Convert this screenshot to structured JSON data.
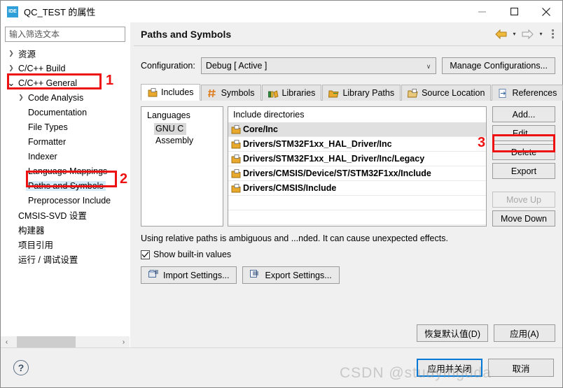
{
  "window": {
    "title": "QC_TEST 的属性",
    "app_icon_text": "IDE",
    "controls": {
      "minimize": "minimize-icon",
      "maximize": "maximize-icon",
      "close": "close-icon"
    }
  },
  "sidebar": {
    "filter_placeholder": "输入筛选文本",
    "filter_value": "",
    "items": [
      {
        "label": "资源",
        "arrow": "›",
        "indent": 0,
        "selected": false
      },
      {
        "label": "C/C++ Build",
        "arrow": "›",
        "indent": 0,
        "selected": false
      },
      {
        "label": "C/C++ General",
        "arrow": "v",
        "indent": 0,
        "selected": false
      },
      {
        "label": "Code Analysis",
        "arrow": "›",
        "indent": 1,
        "selected": false
      },
      {
        "label": "Documentation",
        "arrow": "",
        "indent": 1,
        "selected": false
      },
      {
        "label": "File Types",
        "arrow": "",
        "indent": 1,
        "selected": false
      },
      {
        "label": "Formatter",
        "arrow": "",
        "indent": 1,
        "selected": false
      },
      {
        "label": "Indexer",
        "arrow": "",
        "indent": 1,
        "selected": false
      },
      {
        "label": "Language Mappings",
        "arrow": "",
        "indent": 1,
        "selected": false
      },
      {
        "label": "Paths and Symbols",
        "arrow": "",
        "indent": 1,
        "selected": true
      },
      {
        "label": "Preprocessor Include",
        "arrow": "",
        "indent": 1,
        "selected": false
      },
      {
        "label": "CMSIS-SVD 设置",
        "arrow": "",
        "indent": 0,
        "selected": false
      },
      {
        "label": "构建器",
        "arrow": "",
        "indent": 0,
        "selected": false
      },
      {
        "label": "项目引用",
        "arrow": "",
        "indent": 0,
        "selected": false
      },
      {
        "label": "运行 / 调试设置",
        "arrow": "",
        "indent": 0,
        "selected": false
      }
    ],
    "scroll_left": "‹",
    "scroll_right": "›"
  },
  "page": {
    "title": "Paths and Symbols",
    "nav": {
      "back": "back-arrow-icon",
      "back_caret": "▾",
      "forward": "forward-arrow-icon",
      "forward_caret": "▾",
      "more": "view-menu-icon"
    }
  },
  "configuration": {
    "label": "Configuration:",
    "value": "Debug  [ Active ]",
    "caret": "∨",
    "manage_button": "Manage Configurations..."
  },
  "tabs": [
    {
      "label": "Includes",
      "icon": "includes-icon",
      "active": true
    },
    {
      "label": "Symbols",
      "icon": "symbols-hash-icon",
      "active": false
    },
    {
      "label": "Libraries",
      "icon": "libraries-icon",
      "active": false
    },
    {
      "label": "Library Paths",
      "icon": "library-paths-icon",
      "active": false
    },
    {
      "label": "Source Location",
      "icon": "source-location-icon",
      "active": false
    },
    {
      "label": "References",
      "icon": "references-icon",
      "active": false
    }
  ],
  "languages": {
    "title": "Languages",
    "items": [
      {
        "label": "GNU C",
        "selected": true
      },
      {
        "label": "Assembly",
        "selected": false
      }
    ]
  },
  "include_directories": {
    "title": "Include directories",
    "rows": [
      {
        "label": "Core/Inc",
        "selected": true
      },
      {
        "label": "Drivers/STM32F1xx_HAL_Driver/Inc",
        "selected": false
      },
      {
        "label": "Drivers/STM32F1xx_HAL_Driver/Inc/Legacy",
        "selected": false
      },
      {
        "label": "Drivers/CMSIS/Device/ST/STM32F1xx/Include",
        "selected": false
      },
      {
        "label": "Drivers/CMSIS/Include",
        "selected": false
      }
    ],
    "empty_rows": 2
  },
  "side_buttons": [
    {
      "label": "Add...",
      "disabled": false,
      "highlighted": true
    },
    {
      "label": "Edit...",
      "disabled": false,
      "highlighted": false
    },
    {
      "label": "Delete",
      "disabled": false,
      "highlighted": false
    },
    {
      "label": "Export",
      "disabled": false,
      "highlighted": false
    },
    {
      "label": "Move Up",
      "disabled": true,
      "highlighted": false
    },
    {
      "label": "Move Down",
      "disabled": false,
      "highlighted": false
    }
  ],
  "note": "Using relative paths is ambiguous and ...nded. It can cause unexpected effects.",
  "show_builtin": {
    "label": "Show built-in values",
    "checked": true,
    "check_glyph": "✓"
  },
  "settings_buttons": [
    {
      "label": "Import Settings...",
      "icon": "import-settings-icon"
    },
    {
      "label": "Export Settings...",
      "icon": "export-settings-icon"
    }
  ],
  "restore_row": [
    {
      "label": "恢复默认值(D)"
    },
    {
      "label": "应用(A)"
    }
  ],
  "footer": {
    "help": "?",
    "buttons": [
      {
        "label": "应用并关闭",
        "default": true
      },
      {
        "label": "取消",
        "default": false
      }
    ]
  },
  "annotations": [
    {
      "number": "1",
      "target": "sidebar-item-cpp-general"
    },
    {
      "number": "2",
      "target": "sidebar-item-paths-and-symbols"
    },
    {
      "number": "3",
      "target": "add-button"
    }
  ],
  "watermark": "CSDN @studyingdda",
  "colors": {
    "accent": "#0078d7",
    "annotation": "#ee1111",
    "selection": "#d6ebf9",
    "panel": "#f0f0f0",
    "app_icon": "#2e9fd8"
  }
}
